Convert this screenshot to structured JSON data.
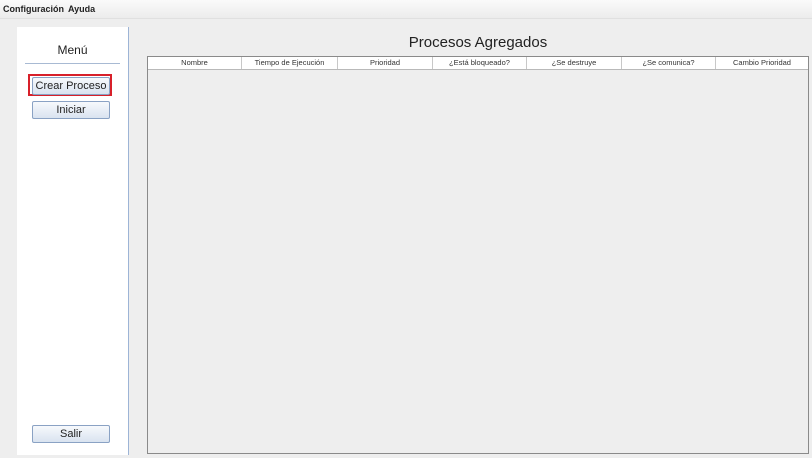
{
  "menubar": {
    "items": [
      "Configuración",
      "Ayuda"
    ]
  },
  "sidebar": {
    "title": "Menú",
    "buttons": {
      "create": "Crear Proceso",
      "start": "Iniciar",
      "exit": "Salir"
    }
  },
  "main": {
    "title": "Procesos Agregados",
    "columns": [
      "Nombre",
      "Tiempo de Ejecución",
      "Prioridad",
      "¿Está bloqueado?",
      "¿Se destruye",
      "¿Se comunica?",
      "Cambio Prioridad"
    ],
    "rows": []
  },
  "colors": {
    "highlight": "#d8202a",
    "sidebar_border": "#9db4d6"
  }
}
